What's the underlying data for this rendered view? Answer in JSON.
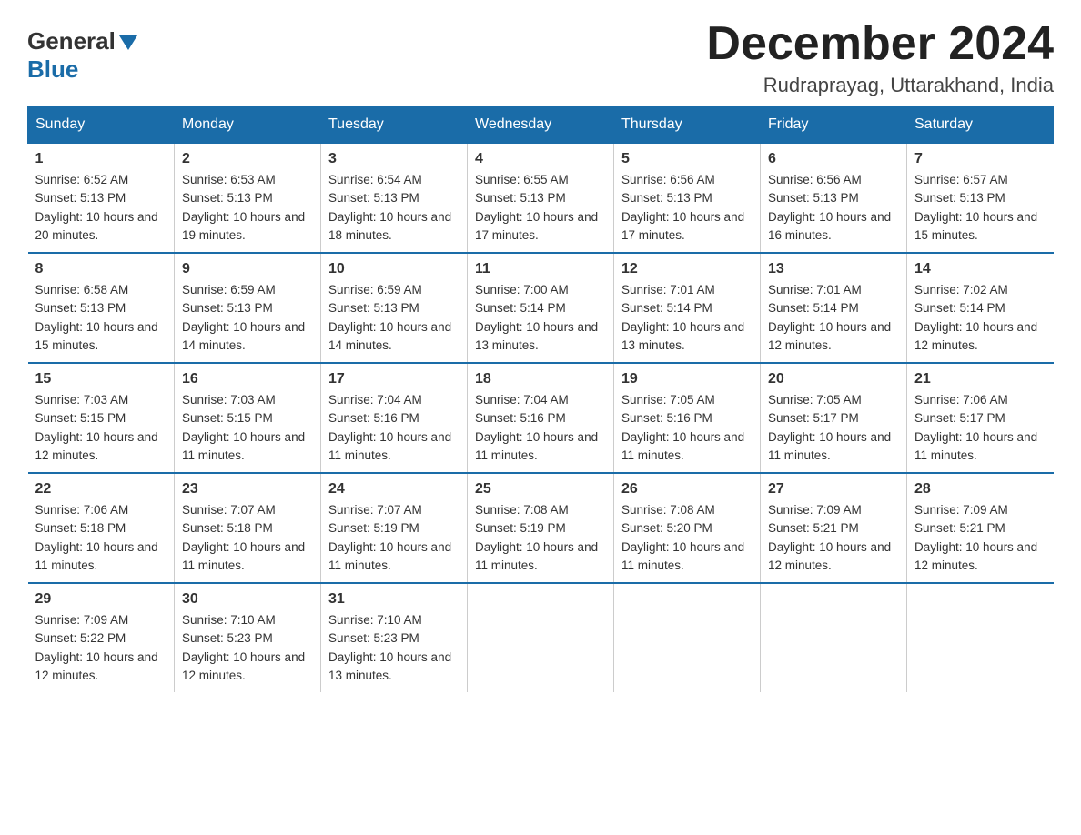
{
  "header": {
    "logo_general": "General",
    "logo_blue": "Blue",
    "month_title": "December 2024",
    "location": "Rudraprayag, Uttarakhand, India"
  },
  "days_of_week": [
    "Sunday",
    "Monday",
    "Tuesday",
    "Wednesday",
    "Thursday",
    "Friday",
    "Saturday"
  ],
  "weeks": [
    [
      {
        "day": "1",
        "sunrise": "6:52 AM",
        "sunset": "5:13 PM",
        "daylight": "10 hours and 20 minutes."
      },
      {
        "day": "2",
        "sunrise": "6:53 AM",
        "sunset": "5:13 PM",
        "daylight": "10 hours and 19 minutes."
      },
      {
        "day": "3",
        "sunrise": "6:54 AM",
        "sunset": "5:13 PM",
        "daylight": "10 hours and 18 minutes."
      },
      {
        "day": "4",
        "sunrise": "6:55 AM",
        "sunset": "5:13 PM",
        "daylight": "10 hours and 17 minutes."
      },
      {
        "day": "5",
        "sunrise": "6:56 AM",
        "sunset": "5:13 PM",
        "daylight": "10 hours and 17 minutes."
      },
      {
        "day": "6",
        "sunrise": "6:56 AM",
        "sunset": "5:13 PM",
        "daylight": "10 hours and 16 minutes."
      },
      {
        "day": "7",
        "sunrise": "6:57 AM",
        "sunset": "5:13 PM",
        "daylight": "10 hours and 15 minutes."
      }
    ],
    [
      {
        "day": "8",
        "sunrise": "6:58 AM",
        "sunset": "5:13 PM",
        "daylight": "10 hours and 15 minutes."
      },
      {
        "day": "9",
        "sunrise": "6:59 AM",
        "sunset": "5:13 PM",
        "daylight": "10 hours and 14 minutes."
      },
      {
        "day": "10",
        "sunrise": "6:59 AM",
        "sunset": "5:13 PM",
        "daylight": "10 hours and 14 minutes."
      },
      {
        "day": "11",
        "sunrise": "7:00 AM",
        "sunset": "5:14 PM",
        "daylight": "10 hours and 13 minutes."
      },
      {
        "day": "12",
        "sunrise": "7:01 AM",
        "sunset": "5:14 PM",
        "daylight": "10 hours and 13 minutes."
      },
      {
        "day": "13",
        "sunrise": "7:01 AM",
        "sunset": "5:14 PM",
        "daylight": "10 hours and 12 minutes."
      },
      {
        "day": "14",
        "sunrise": "7:02 AM",
        "sunset": "5:14 PM",
        "daylight": "10 hours and 12 minutes."
      }
    ],
    [
      {
        "day": "15",
        "sunrise": "7:03 AM",
        "sunset": "5:15 PM",
        "daylight": "10 hours and 12 minutes."
      },
      {
        "day": "16",
        "sunrise": "7:03 AM",
        "sunset": "5:15 PM",
        "daylight": "10 hours and 11 minutes."
      },
      {
        "day": "17",
        "sunrise": "7:04 AM",
        "sunset": "5:16 PM",
        "daylight": "10 hours and 11 minutes."
      },
      {
        "day": "18",
        "sunrise": "7:04 AM",
        "sunset": "5:16 PM",
        "daylight": "10 hours and 11 minutes."
      },
      {
        "day": "19",
        "sunrise": "7:05 AM",
        "sunset": "5:16 PM",
        "daylight": "10 hours and 11 minutes."
      },
      {
        "day": "20",
        "sunrise": "7:05 AM",
        "sunset": "5:17 PM",
        "daylight": "10 hours and 11 minutes."
      },
      {
        "day": "21",
        "sunrise": "7:06 AM",
        "sunset": "5:17 PM",
        "daylight": "10 hours and 11 minutes."
      }
    ],
    [
      {
        "day": "22",
        "sunrise": "7:06 AM",
        "sunset": "5:18 PM",
        "daylight": "10 hours and 11 minutes."
      },
      {
        "day": "23",
        "sunrise": "7:07 AM",
        "sunset": "5:18 PM",
        "daylight": "10 hours and 11 minutes."
      },
      {
        "day": "24",
        "sunrise": "7:07 AM",
        "sunset": "5:19 PM",
        "daylight": "10 hours and 11 minutes."
      },
      {
        "day": "25",
        "sunrise": "7:08 AM",
        "sunset": "5:19 PM",
        "daylight": "10 hours and 11 minutes."
      },
      {
        "day": "26",
        "sunrise": "7:08 AM",
        "sunset": "5:20 PM",
        "daylight": "10 hours and 11 minutes."
      },
      {
        "day": "27",
        "sunrise": "7:09 AM",
        "sunset": "5:21 PM",
        "daylight": "10 hours and 12 minutes."
      },
      {
        "day": "28",
        "sunrise": "7:09 AM",
        "sunset": "5:21 PM",
        "daylight": "10 hours and 12 minutes."
      }
    ],
    [
      {
        "day": "29",
        "sunrise": "7:09 AM",
        "sunset": "5:22 PM",
        "daylight": "10 hours and 12 minutes."
      },
      {
        "day": "30",
        "sunrise": "7:10 AM",
        "sunset": "5:23 PM",
        "daylight": "10 hours and 12 minutes."
      },
      {
        "day": "31",
        "sunrise": "7:10 AM",
        "sunset": "5:23 PM",
        "daylight": "10 hours and 13 minutes."
      },
      null,
      null,
      null,
      null
    ]
  ]
}
